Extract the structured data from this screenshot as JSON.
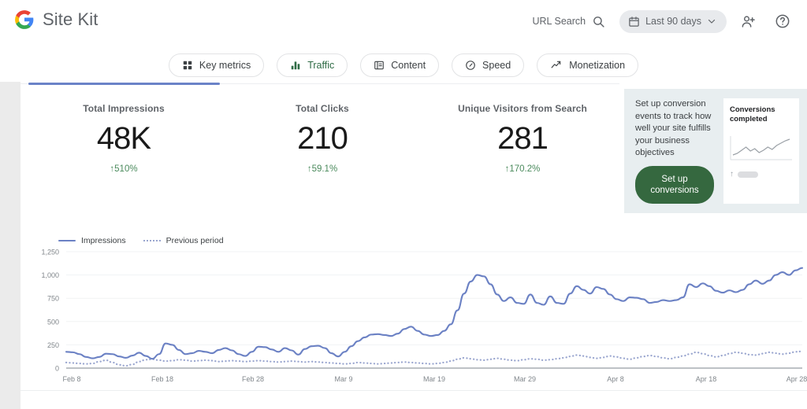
{
  "header": {
    "brand": "Site Kit",
    "logo_icon": "google-g-logo",
    "url_search_label": "URL Search",
    "search_icon": "search-icon",
    "date_range_label": "Last 90 days",
    "calendar_icon": "calendar-icon",
    "chevron_icon": "chevron-down-icon",
    "add_user_icon": "person-add-icon",
    "help_icon": "help-circle-icon"
  },
  "tabs": [
    {
      "label": "Key metrics",
      "icon": "grid-squares-icon",
      "active": false
    },
    {
      "label": "Traffic",
      "icon": "bar-chart-icon",
      "active": true
    },
    {
      "label": "Content",
      "icon": "content-list-icon",
      "active": false
    },
    {
      "label": "Speed",
      "icon": "speedometer-icon",
      "active": false
    },
    {
      "label": "Monetization",
      "icon": "trend-up-icon",
      "active": false
    }
  ],
  "metrics": [
    {
      "label": "Total Impressions",
      "value": "48K",
      "delta": "↑510%",
      "selected": true
    },
    {
      "label": "Total Clicks",
      "value": "210",
      "delta": "↑59.1%",
      "selected": false
    },
    {
      "label": "Unique Visitors from Search",
      "value": "281",
      "delta": "↑170.2%",
      "selected": false
    }
  ],
  "cta": {
    "text": "Set up conversion events to track how well your site fulfills your business objectives",
    "button_label": "Set up conversions",
    "preview_title": "Conversions completed",
    "preview_arrow": "↑",
    "accent_color": "#35683f",
    "panel_color": "#e8eef0"
  },
  "chart_data": {
    "type": "line",
    "title": "",
    "xlabel": "",
    "ylabel": "",
    "ylim": [
      0,
      1250
    ],
    "yticks": [
      0,
      250,
      500,
      750,
      1000,
      1250
    ],
    "ytick_labels": [
      "0",
      "250",
      "500",
      "750",
      "1,000",
      "1,250"
    ],
    "xtick_labels": [
      "Feb 8",
      "Feb 18",
      "Feb 28",
      "Mar 9",
      "Mar 19",
      "Mar 29",
      "Apr 8",
      "Apr 18",
      "Apr 28"
    ],
    "grid": true,
    "legend_position": "top-left",
    "series": [
      {
        "name": "Impressions",
        "color": "#6b81c4",
        "style": "solid",
        "values": [
          175,
          170,
          150,
          120,
          105,
          120,
          155,
          150,
          125,
          110,
          135,
          165,
          130,
          100,
          150,
          265,
          250,
          195,
          150,
          160,
          185,
          175,
          160,
          195,
          215,
          190,
          150,
          130,
          175,
          230,
          225,
          200,
          175,
          215,
          190,
          145,
          205,
          235,
          240,
          215,
          160,
          125,
          175,
          235,
          290,
          330,
          360,
          365,
          355,
          345,
          370,
          420,
          445,
          400,
          360,
          345,
          355,
          400,
          470,
          620,
          800,
          930,
          1000,
          985,
          900,
          790,
          720,
          760,
          700,
          690,
          790,
          700,
          680,
          770,
          700,
          690,
          800,
          880,
          840,
          800,
          870,
          850,
          790,
          740,
          720,
          760,
          755,
          740,
          700,
          710,
          730,
          720,
          730,
          760,
          900,
          870,
          910,
          880,
          830,
          810,
          835,
          815,
          840,
          900,
          940,
          905,
          940,
          1000,
          1030,
          1000,
          1050,
          1075
        ]
      },
      {
        "name": "Previous period",
        "color": "#9aa6cf",
        "style": "dotted",
        "values": [
          60,
          55,
          50,
          45,
          50,
          70,
          85,
          60,
          35,
          25,
          40,
          70,
          90,
          95,
          85,
          75,
          80,
          90,
          85,
          75,
          80,
          85,
          80,
          70,
          75,
          80,
          75,
          70,
          75,
          80,
          75,
          70,
          65,
          70,
          75,
          70,
          65,
          70,
          65,
          60,
          55,
          50,
          45,
          50,
          60,
          55,
          50,
          45,
          50,
          55,
          60,
          65,
          60,
          55,
          50,
          45,
          50,
          60,
          75,
          95,
          110,
          100,
          90,
          85,
          95,
          105,
          95,
          85,
          80,
          90,
          100,
          95,
          85,
          90,
          100,
          110,
          125,
          140,
          130,
          115,
          105,
          115,
          130,
          120,
          105,
          95,
          110,
          125,
          135,
          125,
          110,
          100,
          115,
          130,
          150,
          170,
          155,
          135,
          120,
          135,
          155,
          170,
          160,
          145,
          140,
          155,
          170,
          160,
          150,
          160,
          175,
          180
        ]
      }
    ]
  },
  "cta_sparkline": [
    22,
    20,
    16,
    12,
    17,
    14,
    19,
    16,
    12,
    15,
    10,
    7,
    4,
    2
  ]
}
